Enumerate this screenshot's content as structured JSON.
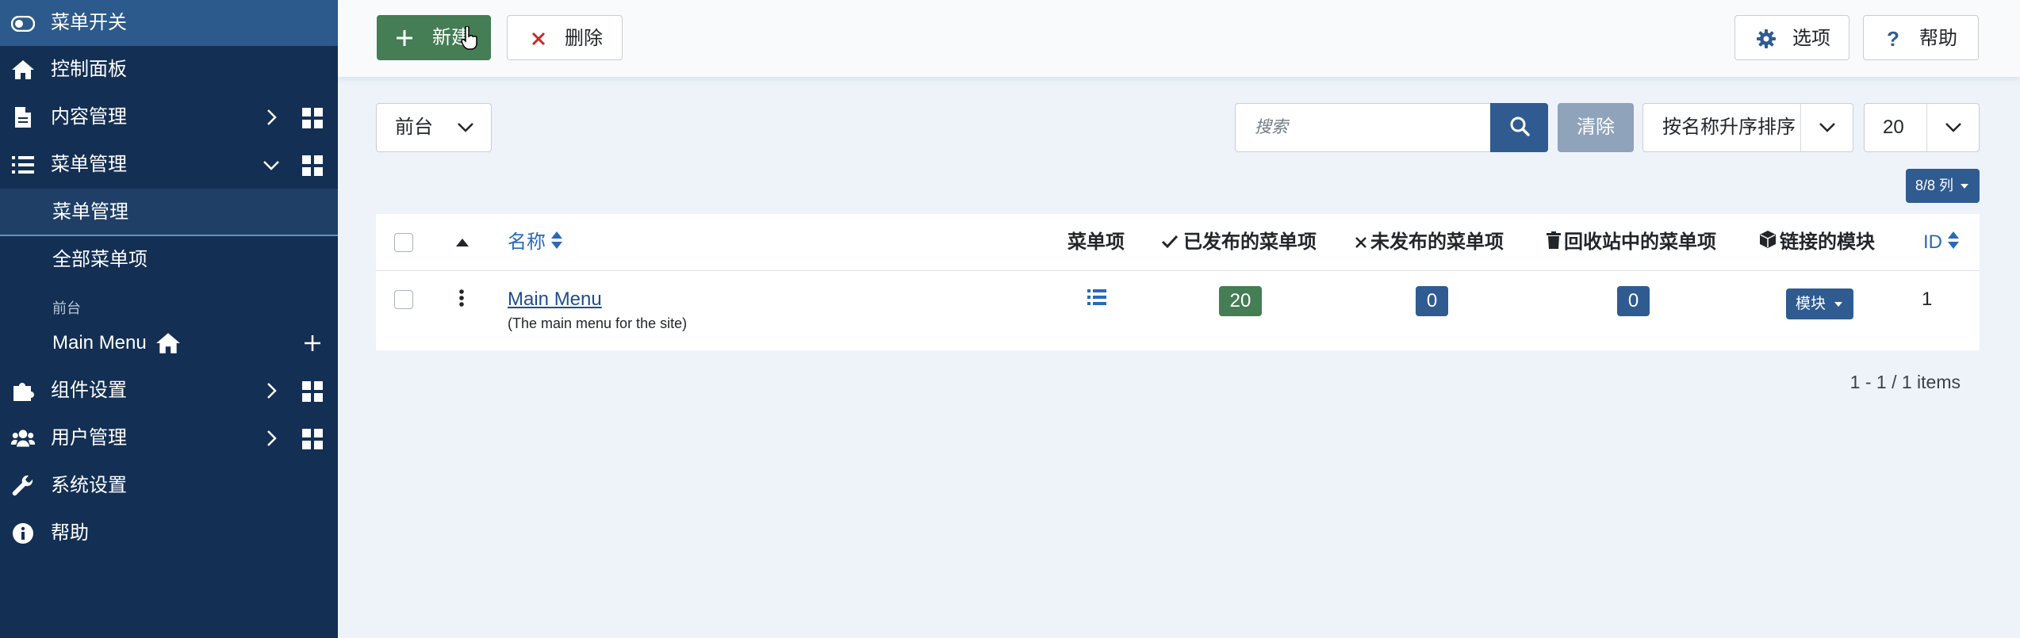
{
  "colors": {
    "sidebar_bg": "#132f53",
    "sidebar_toggle_bg": "#2d5a8c",
    "sidebar_active_bg": "#1f3f66",
    "primary": "#2f5b91",
    "success": "#457d54",
    "danger": "#c52827",
    "link": "#2a69b8",
    "clear_button": "#8fa3ba"
  },
  "sidebar": {
    "toggle": {
      "label": "菜单开关",
      "icon": "toggle-icon"
    },
    "items": [
      {
        "label": "控制面板",
        "icon": "home-icon"
      },
      {
        "label": "内容管理",
        "icon": "file-icon",
        "has_submenu": true,
        "expanded": false,
        "dashboard_icon": "dashboard-grid-icon"
      },
      {
        "label": "菜单管理",
        "icon": "list-icon",
        "has_submenu": true,
        "expanded": true,
        "dashboard_icon": "dashboard-grid-icon"
      },
      {
        "label": "组件设置",
        "icon": "puzzle-icon",
        "has_submenu": true,
        "expanded": false,
        "dashboard_icon": "dashboard-grid-icon"
      },
      {
        "label": "用户管理",
        "icon": "users-icon",
        "has_submenu": true,
        "expanded": false,
        "dashboard_icon": "dashboard-grid-icon"
      },
      {
        "label": "系统设置",
        "icon": "wrench-icon"
      },
      {
        "label": "帮助",
        "icon": "info-icon"
      }
    ],
    "submenu": {
      "active_item": "菜单管理",
      "all_items": "全部菜单项",
      "group_label": "前台",
      "menu_entry": {
        "label": "Main Menu",
        "icon": "home-icon",
        "add_icon": "plus-icon"
      }
    }
  },
  "toolbar": {
    "new_label": "新建",
    "delete_label": "删除",
    "options_label": "选项",
    "help_label": "帮助"
  },
  "filters": {
    "client_value": "前台",
    "search_placeholder": "搜索",
    "clear_label": "清除",
    "sort_value": "按名称升序排序",
    "limit_value": "20",
    "columns_label": "8/8 列"
  },
  "table": {
    "headers": {
      "name": "名称",
      "items": "菜单项",
      "published": "已发布的菜单项",
      "unpublished": "未发布的菜单项",
      "trashed": "回收站中的菜单项",
      "modules": "链接的模块",
      "id": "ID"
    },
    "rows": [
      {
        "name": "Main Menu",
        "description": "(The main menu for the site)",
        "published": "20",
        "unpublished": "0",
        "trashed": "0",
        "modules_label": "模块",
        "id": "1"
      }
    ]
  },
  "pagination": {
    "text": "1 - 1 / 1 items"
  }
}
